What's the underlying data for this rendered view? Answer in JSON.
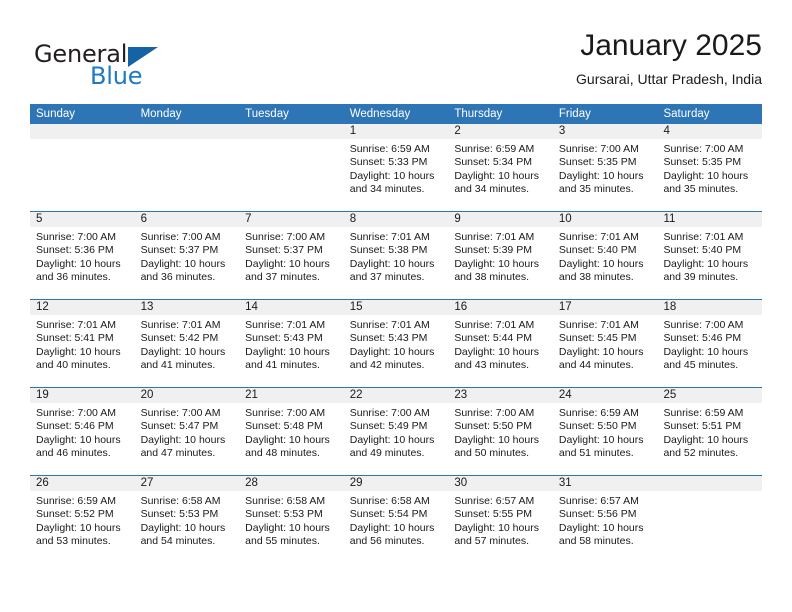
{
  "brand": {
    "name_part1": "General",
    "name_part2": "Blue"
  },
  "header": {
    "title": "January 2025",
    "subtitle": "Gursarai, Uttar Pradesh, India"
  },
  "weekdays": [
    "Sunday",
    "Monday",
    "Tuesday",
    "Wednesday",
    "Thursday",
    "Friday",
    "Saturday"
  ],
  "labels": {
    "sunrise_prefix": "Sunrise:",
    "sunset_prefix": "Sunset:",
    "daylight_prefix": "Daylight:"
  },
  "colors": {
    "header_blue": "#2e75b6",
    "brand_blue": "#1e7ac4",
    "day_band_gray": "#f0f0f0"
  },
  "weeks": [
    [
      {
        "day": "",
        "empty": true
      },
      {
        "day": "",
        "empty": true
      },
      {
        "day": "",
        "empty": true
      },
      {
        "day": "1",
        "sunrise": "Sunrise: 6:59 AM",
        "sunset": "Sunset: 5:33 PM",
        "daylight_line1": "Daylight: 10 hours",
        "daylight_line2": "and 34 minutes."
      },
      {
        "day": "2",
        "sunrise": "Sunrise: 6:59 AM",
        "sunset": "Sunset: 5:34 PM",
        "daylight_line1": "Daylight: 10 hours",
        "daylight_line2": "and 34 minutes."
      },
      {
        "day": "3",
        "sunrise": "Sunrise: 7:00 AM",
        "sunset": "Sunset: 5:35 PM",
        "daylight_line1": "Daylight: 10 hours",
        "daylight_line2": "and 35 minutes."
      },
      {
        "day": "4",
        "sunrise": "Sunrise: 7:00 AM",
        "sunset": "Sunset: 5:35 PM",
        "daylight_line1": "Daylight: 10 hours",
        "daylight_line2": "and 35 minutes."
      }
    ],
    [
      {
        "day": "5",
        "sunrise": "Sunrise: 7:00 AM",
        "sunset": "Sunset: 5:36 PM",
        "daylight_line1": "Daylight: 10 hours",
        "daylight_line2": "and 36 minutes."
      },
      {
        "day": "6",
        "sunrise": "Sunrise: 7:00 AM",
        "sunset": "Sunset: 5:37 PM",
        "daylight_line1": "Daylight: 10 hours",
        "daylight_line2": "and 36 minutes."
      },
      {
        "day": "7",
        "sunrise": "Sunrise: 7:00 AM",
        "sunset": "Sunset: 5:37 PM",
        "daylight_line1": "Daylight: 10 hours",
        "daylight_line2": "and 37 minutes."
      },
      {
        "day": "8",
        "sunrise": "Sunrise: 7:01 AM",
        "sunset": "Sunset: 5:38 PM",
        "daylight_line1": "Daylight: 10 hours",
        "daylight_line2": "and 37 minutes."
      },
      {
        "day": "9",
        "sunrise": "Sunrise: 7:01 AM",
        "sunset": "Sunset: 5:39 PM",
        "daylight_line1": "Daylight: 10 hours",
        "daylight_line2": "and 38 minutes."
      },
      {
        "day": "10",
        "sunrise": "Sunrise: 7:01 AM",
        "sunset": "Sunset: 5:40 PM",
        "daylight_line1": "Daylight: 10 hours",
        "daylight_line2": "and 38 minutes."
      },
      {
        "day": "11",
        "sunrise": "Sunrise: 7:01 AM",
        "sunset": "Sunset: 5:40 PM",
        "daylight_line1": "Daylight: 10 hours",
        "daylight_line2": "and 39 minutes."
      }
    ],
    [
      {
        "day": "12",
        "sunrise": "Sunrise: 7:01 AM",
        "sunset": "Sunset: 5:41 PM",
        "daylight_line1": "Daylight: 10 hours",
        "daylight_line2": "and 40 minutes."
      },
      {
        "day": "13",
        "sunrise": "Sunrise: 7:01 AM",
        "sunset": "Sunset: 5:42 PM",
        "daylight_line1": "Daylight: 10 hours",
        "daylight_line2": "and 41 minutes."
      },
      {
        "day": "14",
        "sunrise": "Sunrise: 7:01 AM",
        "sunset": "Sunset: 5:43 PM",
        "daylight_line1": "Daylight: 10 hours",
        "daylight_line2": "and 41 minutes."
      },
      {
        "day": "15",
        "sunrise": "Sunrise: 7:01 AM",
        "sunset": "Sunset: 5:43 PM",
        "daylight_line1": "Daylight: 10 hours",
        "daylight_line2": "and 42 minutes."
      },
      {
        "day": "16",
        "sunrise": "Sunrise: 7:01 AM",
        "sunset": "Sunset: 5:44 PM",
        "daylight_line1": "Daylight: 10 hours",
        "daylight_line2": "and 43 minutes."
      },
      {
        "day": "17",
        "sunrise": "Sunrise: 7:01 AM",
        "sunset": "Sunset: 5:45 PM",
        "daylight_line1": "Daylight: 10 hours",
        "daylight_line2": "and 44 minutes."
      },
      {
        "day": "18",
        "sunrise": "Sunrise: 7:00 AM",
        "sunset": "Sunset: 5:46 PM",
        "daylight_line1": "Daylight: 10 hours",
        "daylight_line2": "and 45 minutes."
      }
    ],
    [
      {
        "day": "19",
        "sunrise": "Sunrise: 7:00 AM",
        "sunset": "Sunset: 5:46 PM",
        "daylight_line1": "Daylight: 10 hours",
        "daylight_line2": "and 46 minutes."
      },
      {
        "day": "20",
        "sunrise": "Sunrise: 7:00 AM",
        "sunset": "Sunset: 5:47 PM",
        "daylight_line1": "Daylight: 10 hours",
        "daylight_line2": "and 47 minutes."
      },
      {
        "day": "21",
        "sunrise": "Sunrise: 7:00 AM",
        "sunset": "Sunset: 5:48 PM",
        "daylight_line1": "Daylight: 10 hours",
        "daylight_line2": "and 48 minutes."
      },
      {
        "day": "22",
        "sunrise": "Sunrise: 7:00 AM",
        "sunset": "Sunset: 5:49 PM",
        "daylight_line1": "Daylight: 10 hours",
        "daylight_line2": "and 49 minutes."
      },
      {
        "day": "23",
        "sunrise": "Sunrise: 7:00 AM",
        "sunset": "Sunset: 5:50 PM",
        "daylight_line1": "Daylight: 10 hours",
        "daylight_line2": "and 50 minutes."
      },
      {
        "day": "24",
        "sunrise": "Sunrise: 6:59 AM",
        "sunset": "Sunset: 5:50 PM",
        "daylight_line1": "Daylight: 10 hours",
        "daylight_line2": "and 51 minutes."
      },
      {
        "day": "25",
        "sunrise": "Sunrise: 6:59 AM",
        "sunset": "Sunset: 5:51 PM",
        "daylight_line1": "Daylight: 10 hours",
        "daylight_line2": "and 52 minutes."
      }
    ],
    [
      {
        "day": "26",
        "sunrise": "Sunrise: 6:59 AM",
        "sunset": "Sunset: 5:52 PM",
        "daylight_line1": "Daylight: 10 hours",
        "daylight_line2": "and 53 minutes."
      },
      {
        "day": "27",
        "sunrise": "Sunrise: 6:58 AM",
        "sunset": "Sunset: 5:53 PM",
        "daylight_line1": "Daylight: 10 hours",
        "daylight_line2": "and 54 minutes."
      },
      {
        "day": "28",
        "sunrise": "Sunrise: 6:58 AM",
        "sunset": "Sunset: 5:53 PM",
        "daylight_line1": "Daylight: 10 hours",
        "daylight_line2": "and 55 minutes."
      },
      {
        "day": "29",
        "sunrise": "Sunrise: 6:58 AM",
        "sunset": "Sunset: 5:54 PM",
        "daylight_line1": "Daylight: 10 hours",
        "daylight_line2": "and 56 minutes."
      },
      {
        "day": "30",
        "sunrise": "Sunrise: 6:57 AM",
        "sunset": "Sunset: 5:55 PM",
        "daylight_line1": "Daylight: 10 hours",
        "daylight_line2": "and 57 minutes."
      },
      {
        "day": "31",
        "sunrise": "Sunrise: 6:57 AM",
        "sunset": "Sunset: 5:56 PM",
        "daylight_line1": "Daylight: 10 hours",
        "daylight_line2": "and 58 minutes."
      },
      {
        "day": "",
        "empty": true
      }
    ]
  ]
}
